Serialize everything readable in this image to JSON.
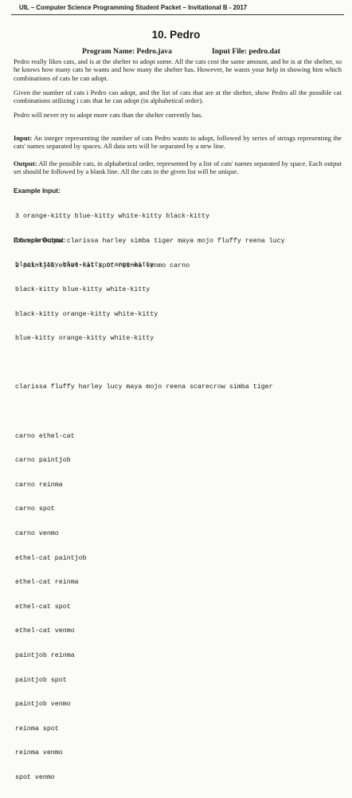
{
  "header": "UIL – Computer Science Programming Student Packet – Invitational B - 2017",
  "title": "10. Pedro",
  "program_name": "Program Name: Pedro.java",
  "input_file": "Input File: pedro.dat",
  "intro": "Pedro really likes cats, and is at the shelter to adopt some. All the cats cost the same amount, and he is at the shelter, so he knows how many cats he wants and how many the shelter has. However, he wants your help in showing him which combinations of cats he can adopt.",
  "given": "Given the number of cats i Pedro can adopt, and the list of cats that are at the shelter, show Pedro all the possible cat combinations utilizing i cats that he can adopt (in alphabetical order).",
  "never": "Pedro will never try to adopt more cats than the shelter currently has.",
  "input_label": "Input:",
  "input_text": "An integer representing the number of cats Pedro wants to adopt, followed by series of strings representing the cats' names separated by spaces. All data sets will be separated by a new line.",
  "output_label": "Output:",
  "output_text": "All the possible cats, in alphabetical order, represented by a list of cats' names separated by space. Each output set should be followed by a blank line. All the cats in the given list will be unique.",
  "example_input_label": "Example Input:",
  "example_input": [
    "3 orange-kitty blue-kitty white-kitty black-kitty",
    "10 scarecrow clarissa harley simba tiger maya mojo fluffy reena lucy",
    "2 paintjob ethel-cat spot reinma venmo carno"
  ],
  "example_output_label": "Example Output:",
  "example_output": [
    "black-kitty blue-kitty orange-kitty",
    "black-kitty blue-kitty white-kitty",
    "black-kitty orange-kitty white-kitty",
    "blue-kitty orange-kitty white-kitty",
    "",
    "clarissa fluffy harley lucy maya mojo reena scarecrow simba tiger",
    "",
    "carno ethel-cat",
    "carno paintjob",
    "carno reinma",
    "carno spot",
    "carno venmo",
    "ethel-cat paintjob",
    "ethel-cat reinma",
    "ethel-cat spot",
    "ethel-cat venmo",
    "paintjob reinma",
    "paintjob spot",
    "paintjob venmo",
    "reinma spot",
    "reinma venmo",
    "spot venmo"
  ]
}
